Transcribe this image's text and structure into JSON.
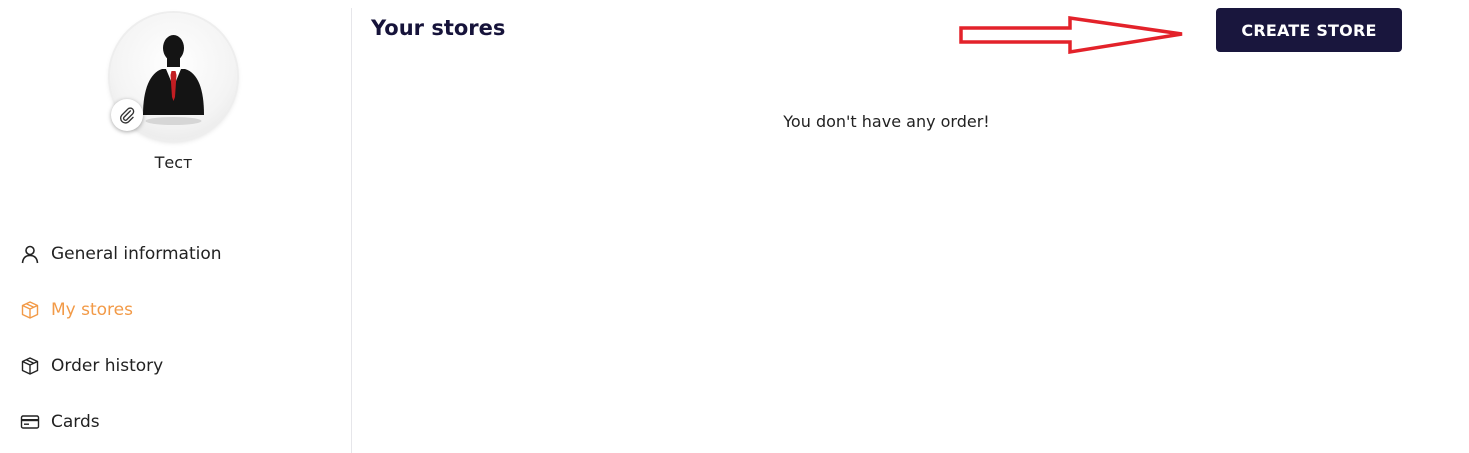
{
  "user": {
    "name": "Тест"
  },
  "sidebar": {
    "items": [
      {
        "label": "General information",
        "icon": "user-icon",
        "active": false
      },
      {
        "label": "My stores",
        "icon": "box-icon",
        "active": true
      },
      {
        "label": "Order history",
        "icon": "package-icon",
        "active": false
      },
      {
        "label": "Cards",
        "icon": "credit-card-icon",
        "active": false
      }
    ]
  },
  "main": {
    "title": "Your stores",
    "empty_message": "You don't have any order!",
    "create_button": "CREATE STORE"
  },
  "colors": {
    "accent": "#f29a47",
    "primary": "#19163d",
    "annotation_arrow": "#e3222a"
  }
}
